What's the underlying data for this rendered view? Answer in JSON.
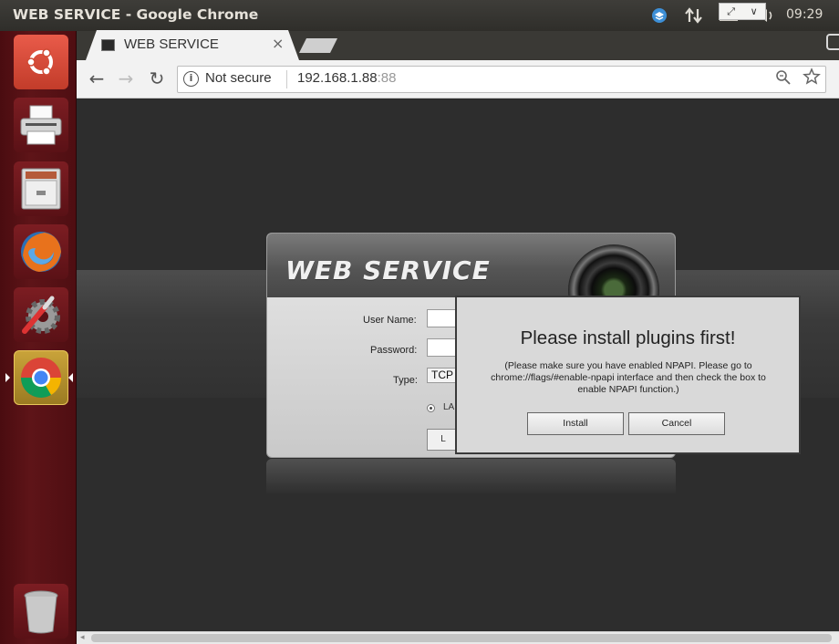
{
  "window": {
    "title": "WEB SERVICE - Google Chrome",
    "clock": "09:29"
  },
  "tab": {
    "title": "WEB SERVICE",
    "close_glyph": "×"
  },
  "toolbar": {
    "back_glyph": "←",
    "forward_glyph": "→",
    "reload_glyph": "↻",
    "security_glyph": "i",
    "security_text": "Not secure",
    "url_host": "192.168.1.88",
    "url_port": ":88",
    "zoom_icon": "search-icon",
    "star_icon": "star-icon"
  },
  "launcher": {
    "items": [
      "ubuntu-dash",
      "printer",
      "file-cabinet",
      "firefox",
      "system-settings",
      "chrome",
      "trash"
    ],
    "active": "chrome"
  },
  "login": {
    "header_title": "WEB  SERVICE",
    "username_label": "User Name:",
    "password_label": "Password:",
    "type_label": "Type:",
    "type_value": "TCP",
    "lan_label": "LA",
    "login_label": "L"
  },
  "dialog": {
    "title": "Please install plugins first!",
    "message": "(Please make sure you have enabled NPAPI. Please go to chrome://flags/#enable-npapi interface and then check the box to enable NPAPI function.)",
    "install_label": "Install",
    "cancel_label": "Cancel"
  },
  "overlay": {
    "expand_glyph": "⤢",
    "chevron_glyph": "∨"
  },
  "colors": {
    "launcher": "#5e1418",
    "panel": "#3e3d39",
    "dialog": "#d9d9d9"
  }
}
